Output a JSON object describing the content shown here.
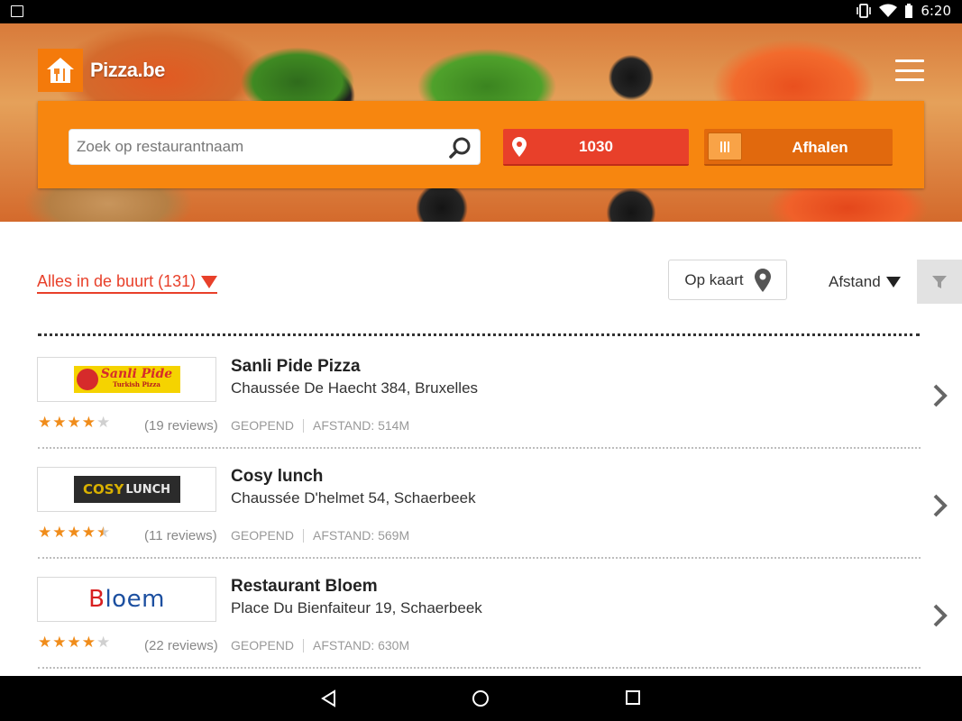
{
  "status_bar": {
    "time": "6:20"
  },
  "header": {
    "logo_text": "Pizza.be"
  },
  "search": {
    "placeholder": "Zoek op restaurantnaam",
    "zip_label": "1030",
    "pickup_label": "Afhalen"
  },
  "filters": {
    "nearby_label": "Alles in de buurt (131)",
    "map_label": "Op kaart",
    "sort_label": "Afstand"
  },
  "restaurants": [
    {
      "name": "Sanli Pide Pizza",
      "address": "Chaussée De Haecht 384, Bruxelles",
      "logo_text": "Sanli Pide",
      "logo_sub": "Turkish Pizza",
      "rating": 4,
      "reviews": "(19 reviews)",
      "status": "GEOPEND",
      "distance": "AFSTAND: 514M"
    },
    {
      "name": "Cosy lunch",
      "address": "Chaussée D'helmet 54, Schaerbeek",
      "logo_text_a": "COSY",
      "logo_text_b": "LUNCH",
      "rating": 4.5,
      "reviews": "(11 reviews)",
      "status": "GEOPEND",
      "distance": "AFSTAND: 569M"
    },
    {
      "name": "Restaurant Bloem",
      "address": "Place Du Bienfaiteur 19, Schaerbeek",
      "logo_text_a": "B",
      "logo_text_b": "loem",
      "rating": 4,
      "reviews": "(22 reviews)",
      "status": "GEOPEND",
      "distance": "AFSTAND: 630M"
    }
  ],
  "colors": {
    "brand_orange": "#f7860f",
    "accent_red": "#e8402a",
    "star": "#f08c1a"
  }
}
